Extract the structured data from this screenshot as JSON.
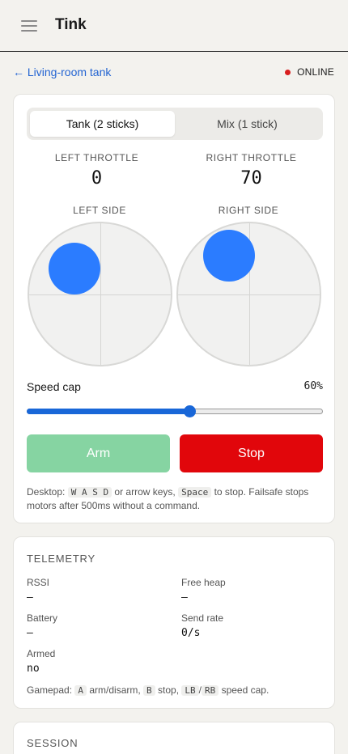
{
  "app": {
    "title": "Tink"
  },
  "nav": {
    "back_label": "← Living-room tank",
    "status": "ONLINE",
    "status_color": "#d81e1e"
  },
  "controls": {
    "modes": [
      "Tank (2 sticks)",
      "Mix (1 stick)"
    ],
    "active_mode": 0,
    "left_throttle_label": "LEFT THROTTLE",
    "left_throttle_value": "0",
    "right_throttle_label": "RIGHT THROTTLE",
    "right_throttle_value": "70",
    "left_side_label": "LEFT SIDE",
    "right_side_label": "RIGHT SIDE",
    "speed_cap_label": "Speed cap",
    "speed_cap_value": "60%",
    "speed_cap_fraction": 0.6,
    "arm_label": "Arm",
    "stop_label": "Stop",
    "help": {
      "prefix": "Desktop:",
      "keys1": "W A S D",
      "mid1": "or arrow keys,",
      "keys2": "Space",
      "suffix": "to stop. Failsafe stops motors after 500ms without a command."
    }
  },
  "telemetry": {
    "title": "TELEMETRY",
    "rssi_label": "RSSI",
    "rssi_value": "—",
    "heap_label": "Free heap",
    "heap_value": "—",
    "battery_label": "Battery",
    "battery_value": "—",
    "rate_label": "Send rate",
    "rate_value": "0/s",
    "armed_label": "Armed",
    "armed_value": "no",
    "gamepad": {
      "prefix": "Gamepad:",
      "k1": "A",
      "t1": "arm/disarm,",
      "k2": "B",
      "t2": "stop,",
      "k3": "LB",
      "sep": "/",
      "k4": "RB",
      "t3": "speed cap."
    }
  },
  "session": {
    "title": "SESSION"
  },
  "colors": {
    "accent": "#2b7cff",
    "stop": "#e1060b",
    "arm": "#86d4a2",
    "link": "#2364d2"
  }
}
